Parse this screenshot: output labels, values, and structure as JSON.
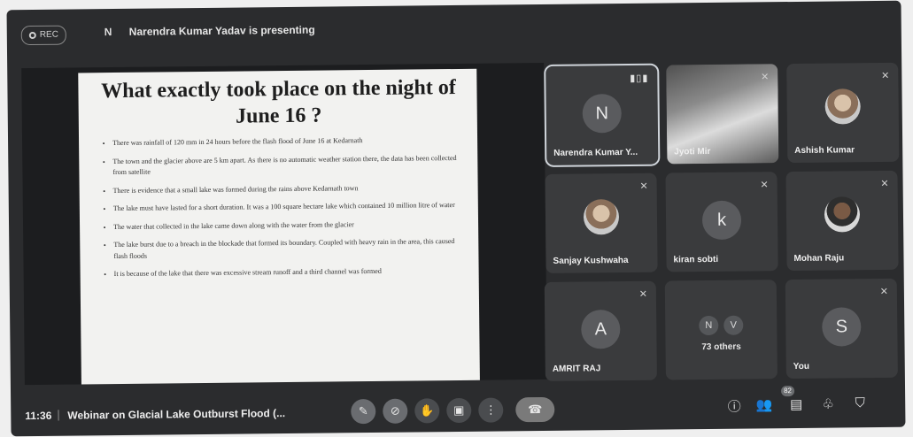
{
  "header": {
    "rec_label": "REC",
    "presenter_initial": "N",
    "presenter_text": "Narendra Kumar Yadav is presenting"
  },
  "slide": {
    "title": "What exactly took place on the night of June 16 ?",
    "bullets": [
      "There was rainfall of 120 mm in 24 hours before the flash flood of June 16 at Kedarnath",
      "The town and the glacier above are 5 km apart. As there is no automatic weather station there, the data has been collected from satellite",
      "There is evidence that a small lake was formed during the rains above Kedarnath town",
      "The lake must have lasted for a short duration. It was a 100 square hectare lake which contained 10 million litre of water",
      "The water that collected in the lake came down along with the water from the glacier",
      "The lake burst due to a breach in the blockade that formed its boundary. Coupled with heavy rain in the area, this caused flash floods",
      "It is because of the lake that there was excessive stream runoff and a third channel was formed"
    ]
  },
  "participants": {
    "tile1": {
      "letter": "N",
      "name": "Narendra Kumar Y...",
      "speaking_icon": "audio-wave-icon"
    },
    "tile2": {
      "name": "Jyoti Mir"
    },
    "tile3": {
      "name": "Ashish Kumar"
    },
    "tile4": {
      "name": "Sanjay Kushwaha"
    },
    "tile5": {
      "letter": "k",
      "name": "kiran sobti"
    },
    "tile6": {
      "name": "Mohan Raju"
    },
    "tile7": {
      "letter": "A",
      "name": "AMRIT RAJ"
    },
    "tile8": {
      "dots": [
        "N",
        "V"
      ],
      "label": "73 others"
    },
    "tile9": {
      "letter": "S",
      "name": "You"
    }
  },
  "bottom_bar": {
    "time": "11:36",
    "separator": "|",
    "meeting_title": "Webinar on Glacial Lake Outburst Flood (...",
    "people_count": "82",
    "controls": [
      "mic-off-icon",
      "camera-off-icon",
      "raise-hand-icon",
      "present-icon",
      "more-options-icon",
      "end-call-icon"
    ],
    "right_icons": [
      "info-icon",
      "people-icon",
      "chat-icon",
      "activities-icon",
      "host-controls-icon"
    ]
  },
  "colors": {
    "background": "#2b2c2e",
    "tile": "#3a3b3d",
    "slide_bg": "#f2f2f0"
  }
}
